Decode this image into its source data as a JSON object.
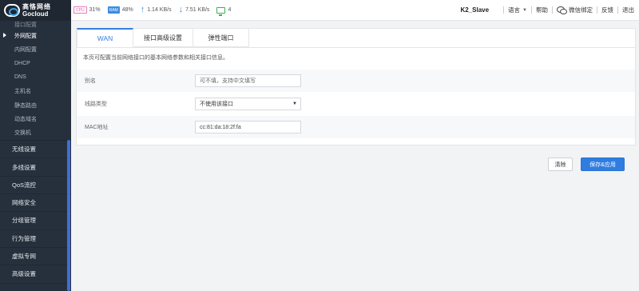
{
  "brand": {
    "name_cn": "高恪网络",
    "name_en": "Gocloud"
  },
  "sidebar": {
    "partial_top": "接口配置",
    "sub_items": [
      {
        "label": "外网配置",
        "active": true
      },
      {
        "label": "内网配置"
      },
      {
        "label": "DHCP"
      },
      {
        "label": "DNS"
      },
      {
        "label": "主机名"
      },
      {
        "label": "静态路由"
      },
      {
        "label": "动态域名"
      },
      {
        "label": "交换机"
      }
    ],
    "main_items": [
      "无线设置",
      "多线设置",
      "QoS流控",
      "网络安全",
      "分组管理",
      "行为管理",
      "虚拟专网",
      "高级设置"
    ]
  },
  "topbar": {
    "cpu_label": "CPU",
    "cpu": "31%",
    "ram_label": "RAM",
    "ram": "48%",
    "upload": "1.14 KB/s",
    "download": "7.51 KB/s",
    "devices": "4",
    "device_name": "K2_Slave",
    "language": "语言",
    "help": "帮助",
    "wechat_bind": "微信绑定",
    "feedback": "反馈",
    "logout": "退出"
  },
  "tabs": [
    "WAN",
    "接口高级设置",
    "弹性端口"
  ],
  "form": {
    "description": "本页可配置当前网络接口的基本网络参数和相关接口信息。",
    "alias_label": "别名",
    "alias_placeholder": "可不填，支持中文填写",
    "line_type_label": "线路类型",
    "line_type_value": "不使用该接口",
    "mac_label": "MAC地址",
    "mac_value": "cc:81:da:18:2f:fa"
  },
  "buttons": {
    "clear": "清除",
    "save": "保存&应用"
  },
  "colors": {
    "accent": "#2f7de1",
    "sidebar_bg": "#26303d"
  }
}
